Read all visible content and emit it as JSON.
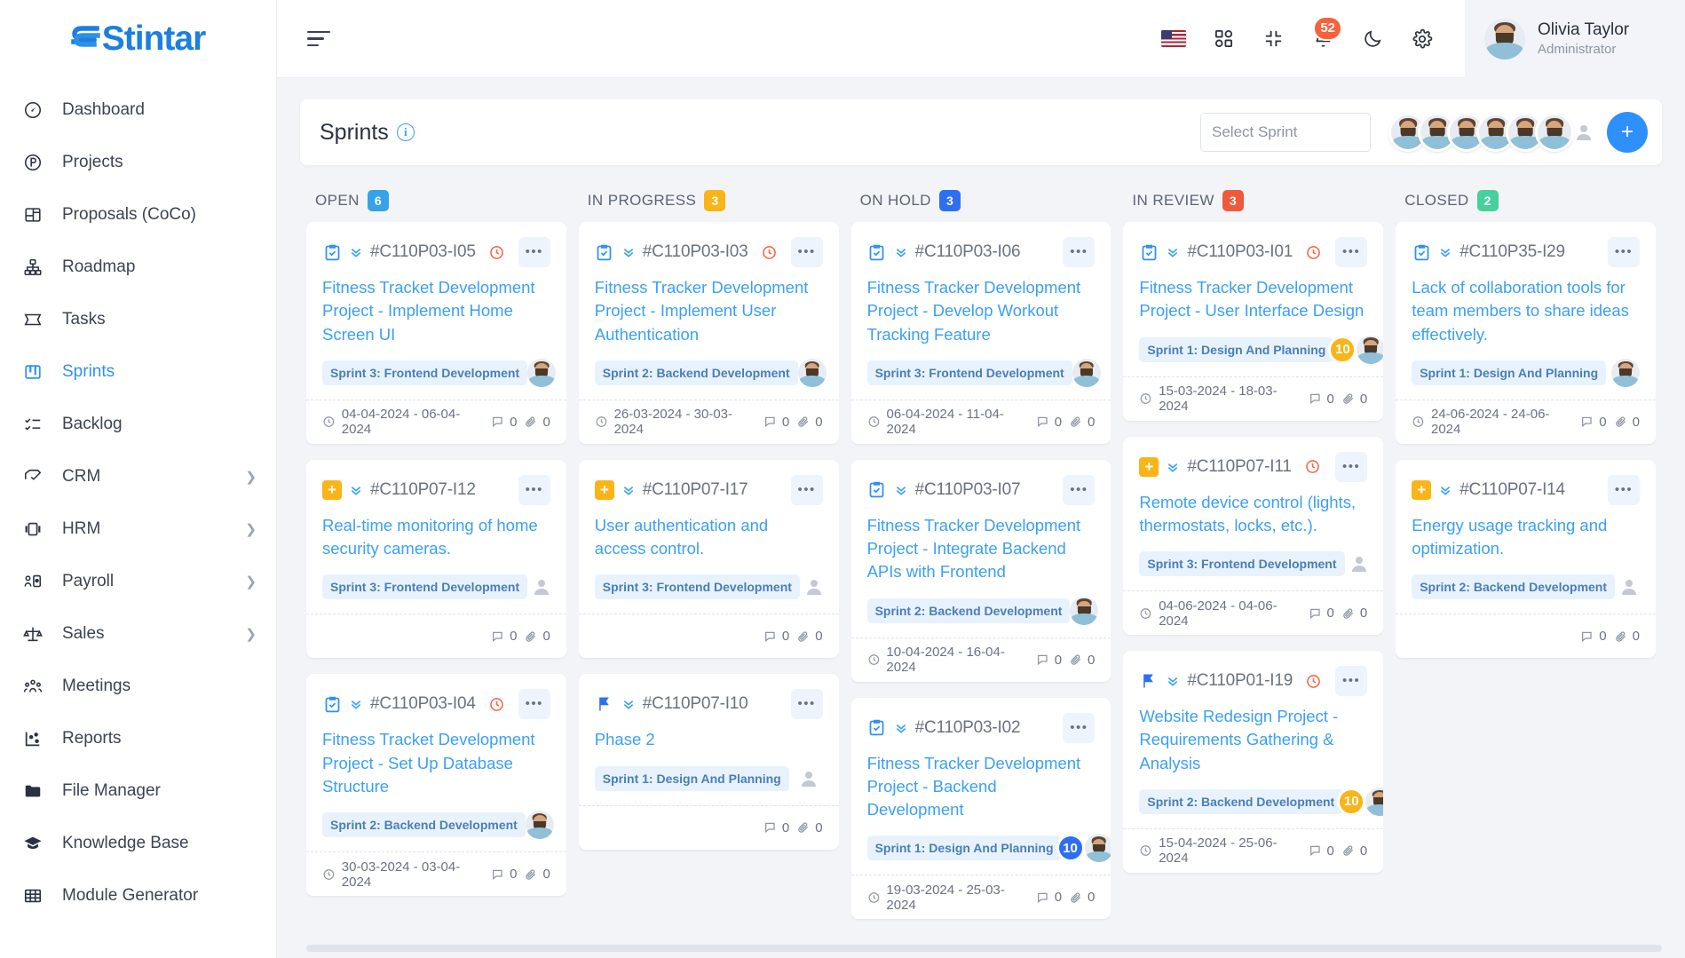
{
  "brand": {
    "name": "Stintar",
    "color": "#1c7fe0"
  },
  "sidebar": {
    "items": [
      {
        "label": "Dashboard",
        "icon": "gauge-icon",
        "active": false,
        "expandable": false
      },
      {
        "label": "Projects",
        "icon": "circle-p-icon",
        "active": false,
        "expandable": false
      },
      {
        "label": "Proposals (CoCo)",
        "icon": "layout-icon",
        "active": false,
        "expandable": false
      },
      {
        "label": "Roadmap",
        "icon": "sitemap-icon",
        "active": false,
        "expandable": false
      },
      {
        "label": "Tasks",
        "icon": "ticket-icon",
        "active": false,
        "expandable": false
      },
      {
        "label": "Sprints",
        "icon": "board-icon",
        "active": true,
        "expandable": false
      },
      {
        "label": "Backlog",
        "icon": "checklist-icon",
        "active": false,
        "expandable": false
      },
      {
        "label": "CRM",
        "icon": "handshake-icon",
        "active": false,
        "expandable": true
      },
      {
        "label": "HRM",
        "icon": "id-card-icon",
        "active": false,
        "expandable": true
      },
      {
        "label": "Payroll",
        "icon": "user-card-icon",
        "active": false,
        "expandable": true
      },
      {
        "label": "Sales",
        "icon": "scales-icon",
        "active": false,
        "expandable": true
      },
      {
        "label": "Meetings",
        "icon": "people-icon",
        "active": false,
        "expandable": false
      },
      {
        "label": "Reports",
        "icon": "scatter-icon",
        "active": false,
        "expandable": false
      },
      {
        "label": "File Manager",
        "icon": "folder-icon",
        "active": false,
        "expandable": false
      },
      {
        "label": "Knowledge Base",
        "icon": "graduation-icon",
        "active": false,
        "expandable": false
      },
      {
        "label": "Module Generator",
        "icon": "grid-table-icon",
        "active": false,
        "expandable": false
      }
    ]
  },
  "topbar": {
    "menu_toggle": "hamburger-icon",
    "language_flag": "us-flag-icon",
    "apps_icon": "apps-grid-icon",
    "compress_icon": "compress-icon",
    "notifications_icon": "bell-icon",
    "notifications_count": "52",
    "dark_mode_icon": "moon-icon",
    "settings_icon": "gear-icon",
    "user": {
      "name": "Olivia Taylor",
      "role": "Administrator"
    }
  },
  "page": {
    "title": "Sprints",
    "info_icon": "info-icon",
    "sprint_select_placeholder": "Select Sprint",
    "add_member_label": "+",
    "member_avatars": 6
  },
  "board": {
    "columns": [
      {
        "title": "OPEN",
        "count": "6",
        "color": "#36a2e8",
        "cards": [
          {
            "type_icon": "task-check-icon",
            "id": "#C110P03-I05",
            "overdue": true,
            "title": "Fitness Tracket Development Project - Implement Home Screen UI",
            "sprint": "Sprint 3: Frontend Development",
            "bubble": null,
            "bubble_color": null,
            "assignee": "avatar",
            "date": "04-04-2024 - 06-04-2024",
            "comments": "0",
            "attachments": "0"
          },
          {
            "type_icon": "plus-square-icon",
            "id": "#C110P07-I12",
            "overdue": false,
            "title": "Real-time monitoring of home security cameras.",
            "sprint": "Sprint 3: Frontend Development",
            "bubble": null,
            "bubble_color": null,
            "assignee": "none",
            "date": null,
            "comments": "0",
            "attachments": "0"
          },
          {
            "type_icon": "task-check-icon",
            "id": "#C110P03-I04",
            "overdue": true,
            "title": "Fitness Tracket Development Project - Set Up Database Structure",
            "sprint": "Sprint 2: Backend Development",
            "bubble": null,
            "bubble_color": null,
            "assignee": "avatar",
            "date": "30-03-2024 - 03-04-2024",
            "comments": "0",
            "attachments": "0"
          }
        ]
      },
      {
        "title": "IN PROGRESS",
        "count": "3",
        "color": "#f9b417",
        "cards": [
          {
            "type_icon": "task-check-icon",
            "id": "#C110P03-I03",
            "overdue": true,
            "title": "Fitness Tracker Development Project - Implement User Authentication",
            "sprint": "Sprint 2: Backend Development",
            "bubble": null,
            "bubble_color": null,
            "assignee": "avatar",
            "date": "26-03-2024 - 30-03-2024",
            "comments": "0",
            "attachments": "0"
          },
          {
            "type_icon": "plus-square-icon",
            "id": "#C110P07-I17",
            "overdue": false,
            "title": "User authentication and access control.",
            "sprint": "Sprint 3: Frontend Development",
            "bubble": null,
            "bubble_color": null,
            "assignee": "none",
            "date": null,
            "comments": "0",
            "attachments": "0"
          },
          {
            "type_icon": "flag-icon",
            "id": "#C110P07-I10",
            "overdue": false,
            "title": "Phase 2",
            "sprint": "Sprint 1: Design And Planning",
            "bubble": null,
            "bubble_color": null,
            "assignee": "none",
            "date": null,
            "comments": "0",
            "attachments": "0"
          }
        ]
      },
      {
        "title": "ON HOLD",
        "count": "3",
        "color": "#2e6ff2",
        "cards": [
          {
            "type_icon": "task-check-icon",
            "id": "#C110P03-I06",
            "overdue": false,
            "title": "Fitness Tracker Development Project - Develop Workout Tracking Feature",
            "sprint": "Sprint 3: Frontend Development",
            "bubble": null,
            "bubble_color": null,
            "assignee": "avatar",
            "date": "06-04-2024 - 11-04-2024",
            "comments": "0",
            "attachments": "0"
          },
          {
            "type_icon": "task-check-icon",
            "id": "#C110P03-I07",
            "overdue": false,
            "title": "Fitness Tracker Development Project - Integrate Backend APIs with Frontend",
            "sprint": "Sprint 2: Backend Development",
            "bubble": null,
            "bubble_color": null,
            "assignee": "avatar",
            "date": "10-04-2024 - 16-04-2024",
            "comments": "0",
            "attachments": "0"
          },
          {
            "type_icon": "task-check-icon",
            "id": "#C110P03-I02",
            "overdue": false,
            "title": "Fitness Tracker Development Project - Backend Development",
            "sprint": "Sprint 1: Design And Planning",
            "bubble": "10",
            "bubble_color": "#2e6ff2",
            "assignee": "avatar",
            "date": "19-03-2024 - 25-03-2024",
            "comments": "0",
            "attachments": "0"
          }
        ]
      },
      {
        "title": "IN REVIEW",
        "count": "3",
        "color": "#f05a3c",
        "cards": [
          {
            "type_icon": "task-check-icon",
            "id": "#C110P03-I01",
            "overdue": true,
            "title": "Fitness Tracker Development Project - User Interface Design",
            "sprint": "Sprint 1: Design And Planning",
            "bubble": "10",
            "bubble_color": "#f9b417",
            "assignee": "avatar",
            "date": "15-03-2024 - 18-03-2024",
            "comments": "0",
            "attachments": "0"
          },
          {
            "type_icon": "plus-square-icon",
            "id": "#C110P07-I11",
            "overdue": true,
            "title": "Remote device control (lights, thermostats, locks, etc.).",
            "sprint": "Sprint 3: Frontend Development",
            "bubble": null,
            "bubble_color": null,
            "assignee": "none",
            "date": "04-06-2024 - 04-06-2024",
            "comments": "0",
            "attachments": "0"
          },
          {
            "type_icon": "flag-icon",
            "id": "#C110P01-I19",
            "overdue": true,
            "title": "Website Redesign Project - Requirements Gathering & Analysis",
            "sprint": "Sprint 2: Backend Development",
            "bubble": "10",
            "bubble_color": "#f9b417",
            "assignee": "avatar",
            "date": "15-04-2024 - 25-06-2024",
            "comments": "0",
            "attachments": "0"
          }
        ]
      },
      {
        "title": "CLOSED",
        "count": "2",
        "color": "#46d09a",
        "cards": [
          {
            "type_icon": "task-check-icon",
            "id": "#C110P35-I29",
            "overdue": false,
            "title": "Lack of collaboration tools for team members to share ideas effectively.",
            "sprint": "Sprint 1: Design And Planning",
            "bubble": null,
            "bubble_color": null,
            "assignee": "avatar",
            "date": "24-06-2024 - 24-06-2024",
            "comments": "0",
            "attachments": "0"
          },
          {
            "type_icon": "plus-square-icon",
            "id": "#C110P07-I14",
            "overdue": false,
            "title": "Energy usage tracking and optimization.",
            "sprint": "Sprint 2: Backend Development",
            "bubble": null,
            "bubble_color": null,
            "assignee": "none",
            "date": null,
            "comments": "0",
            "attachments": "0"
          }
        ]
      }
    ]
  }
}
